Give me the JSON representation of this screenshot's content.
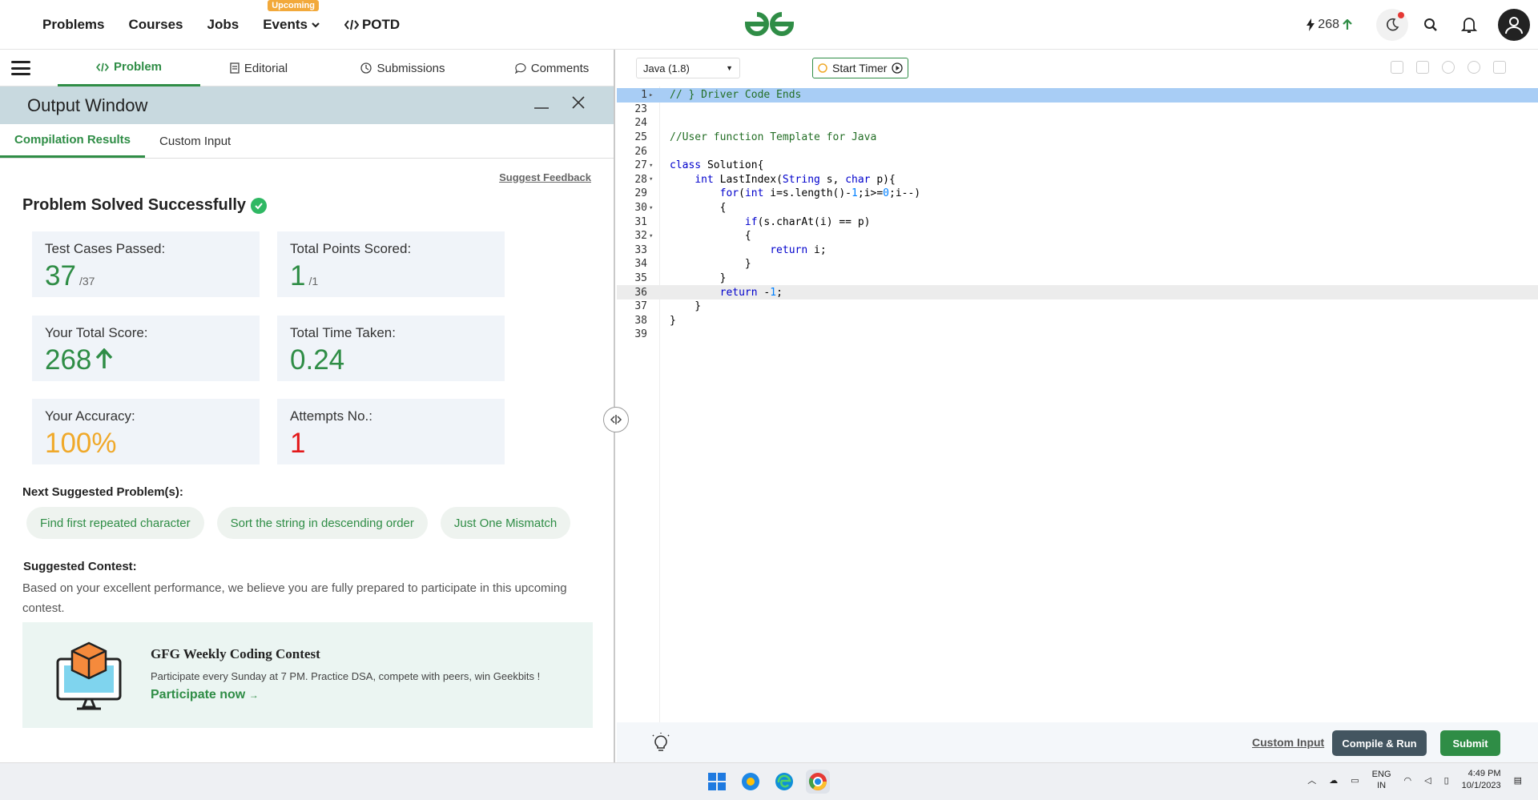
{
  "nav": {
    "links": [
      "Problems",
      "Courses",
      "Jobs",
      "Events",
      "POTD"
    ],
    "upcoming_badge": "Upcoming",
    "streak": "268"
  },
  "left": {
    "tabs": [
      "Problem",
      "Editorial",
      "Submissions",
      "Comments"
    ],
    "output_title": "Output Window",
    "result_tabs": [
      "Compilation Results",
      "Custom Input"
    ],
    "feedback": "Suggest Feedback",
    "solved": "Problem Solved Successfully",
    "stats": {
      "tests_label": "Test Cases Passed:",
      "tests_value": "37",
      "tests_total": "/37",
      "points_label": "Total Points Scored:",
      "points_value": "1",
      "points_total": "/1",
      "score_label": "Your Total Score:",
      "score_value": "268",
      "time_label": "Total Time Taken:",
      "time_value": "0.24",
      "accuracy_label": "Your Accuracy:",
      "accuracy_value": "100%",
      "attempts_label": "Attempts No.:",
      "attempts_value": "1"
    },
    "next_label": "Next Suggested Problem(s):",
    "suggestions": [
      "Find first repeated character",
      "Sort the string in descending order",
      "Just One Mismatch"
    ],
    "contest_label": "Suggested Contest:",
    "contest_desc": "Based on your excellent performance, we believe you are fully prepared to participate in this upcoming contest.",
    "contest_title": "GFG Weekly Coding Contest",
    "contest_text": "Participate every Sunday at 7 PM. Practice DSA, compete with peers, win Geekbits !",
    "participate": "Participate now"
  },
  "editor": {
    "language": "Java (1.8)",
    "timer": "Start Timer",
    "lines": [
      {
        "n": "1",
        "fold": "▸",
        "code": "// } Driver Code Ends"
      },
      {
        "n": "23",
        "fold": "",
        "code": ""
      },
      {
        "n": "24",
        "fold": "",
        "code": ""
      },
      {
        "n": "25",
        "fold": "",
        "code": "//User function Template for Java"
      },
      {
        "n": "26",
        "fold": "",
        "code": ""
      },
      {
        "n": "27",
        "fold": "▾",
        "code": "class Solution{"
      },
      {
        "n": "28",
        "fold": "▾",
        "code": "    int LastIndex(String s, char p){"
      },
      {
        "n": "29",
        "fold": "",
        "code": "        for(int i=s.length()-1;i>=0;i--)"
      },
      {
        "n": "30",
        "fold": "▾",
        "code": "        {"
      },
      {
        "n": "31",
        "fold": "",
        "code": "            if(s.charAt(i) == p)"
      },
      {
        "n": "32",
        "fold": "▾",
        "code": "            {"
      },
      {
        "n": "33",
        "fold": "",
        "code": "                return i;"
      },
      {
        "n": "34",
        "fold": "",
        "code": "            }"
      },
      {
        "n": "35",
        "fold": "",
        "code": "        }"
      },
      {
        "n": "36",
        "fold": "",
        "code": "        return -1;"
      },
      {
        "n": "37",
        "fold": "",
        "code": "    }"
      },
      {
        "n": "38",
        "fold": "",
        "code": "}"
      },
      {
        "n": "39",
        "fold": "",
        "code": ""
      }
    ],
    "custom_input": "Custom Input",
    "compile": "Compile & Run",
    "submit": "Submit"
  },
  "taskbar": {
    "lang1": "ENG",
    "lang2": "IN",
    "time": "4:49 PM",
    "date": "10/1/2023"
  },
  "colors": {
    "accent": "#2f8d46",
    "score_orange": "#f0a92a",
    "attempts_red": "#e3191b"
  }
}
